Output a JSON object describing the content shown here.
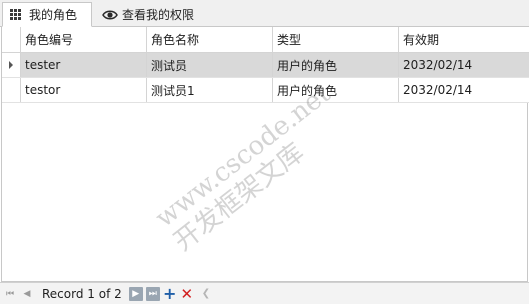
{
  "tabs": [
    {
      "label": "我的角色",
      "icon": "grid-icon",
      "active": true
    },
    {
      "label": "查看我的权限",
      "icon": "eye-icon",
      "active": false
    }
  ],
  "grid": {
    "columns": [
      "角色编号",
      "角色名称",
      "类型",
      "有效期"
    ],
    "rows": [
      {
        "code": "tester",
        "name": "测试员",
        "type": "用户的角色",
        "expiry": "2032/02/14",
        "selected": true
      },
      {
        "code": "testor",
        "name": "测试员1",
        "type": "用户的角色",
        "expiry": "2032/02/14",
        "selected": false
      }
    ]
  },
  "navigator": {
    "record_text": "Record 1 of 2",
    "buttons": [
      "first-icon",
      "prev-icon",
      "next-icon",
      "last-icon",
      "add-icon",
      "delete-icon"
    ]
  },
  "watermark": {
    "line1": "www.cscode.net",
    "line2": "开发框架文库"
  },
  "colors": {
    "selected_row": "#d9d9d9",
    "add": "#1f5fa8",
    "delete": "#d22020"
  }
}
